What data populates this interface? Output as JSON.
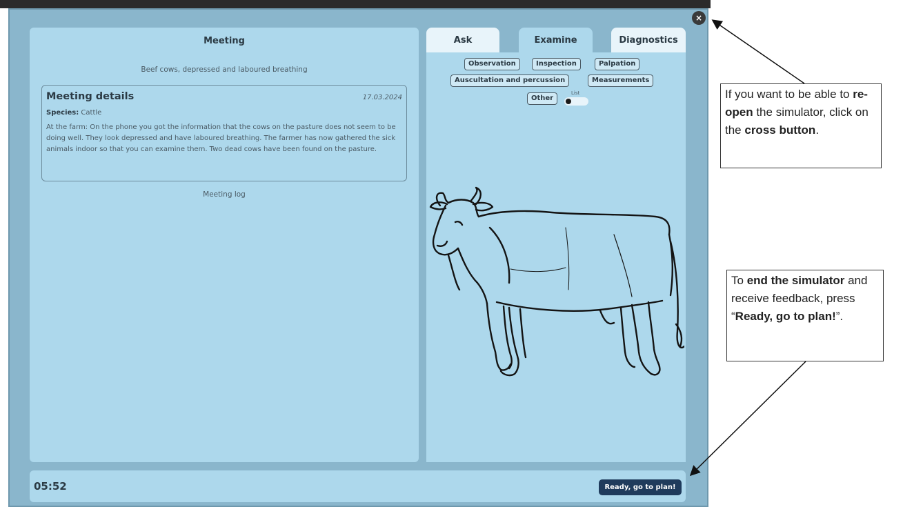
{
  "modal": {
    "close_icon": "×"
  },
  "meeting": {
    "title": "Meeting",
    "subtitle": "Beef cows, depressed and laboured breathing",
    "details": {
      "title": "Meeting details",
      "date": "17.03.2024",
      "species_label": "Species:",
      "species_value": "Cattle",
      "description": "At the farm: On the phone you got the information that the cows on the pasture does not seem to be doing well. They look depressed and have laboured breathing. The farmer has now gathered the sick animals indoor so that you can examine them. Two dead cows have been found on the pasture."
    },
    "log_label": "Meeting log"
  },
  "tabs": [
    {
      "label": "Ask",
      "active": false
    },
    {
      "label": "Examine",
      "active": true
    },
    {
      "label": "Diagnostics",
      "active": false
    }
  ],
  "examine": {
    "chips": [
      "Observation",
      "Inspection",
      "Palpation",
      "Auscultation and percussion",
      "Measurements",
      "Other"
    ],
    "toggle_label": "List",
    "illustration": "cow-illustration"
  },
  "bottom": {
    "timer": "05:52",
    "ready_button": "Ready, go to plan!"
  },
  "annotations": {
    "reopen": {
      "pre": "If you want to be able to ",
      "bold1": "re-open",
      "mid": " the simulator, click on the ",
      "bold2": "cross button",
      "post": "."
    },
    "end": {
      "pre": "To ",
      "bold1": "end the simulator",
      "mid": " and receive feedback, press “",
      "bold2": "Ready, go to plan!",
      "post": "”."
    }
  }
}
